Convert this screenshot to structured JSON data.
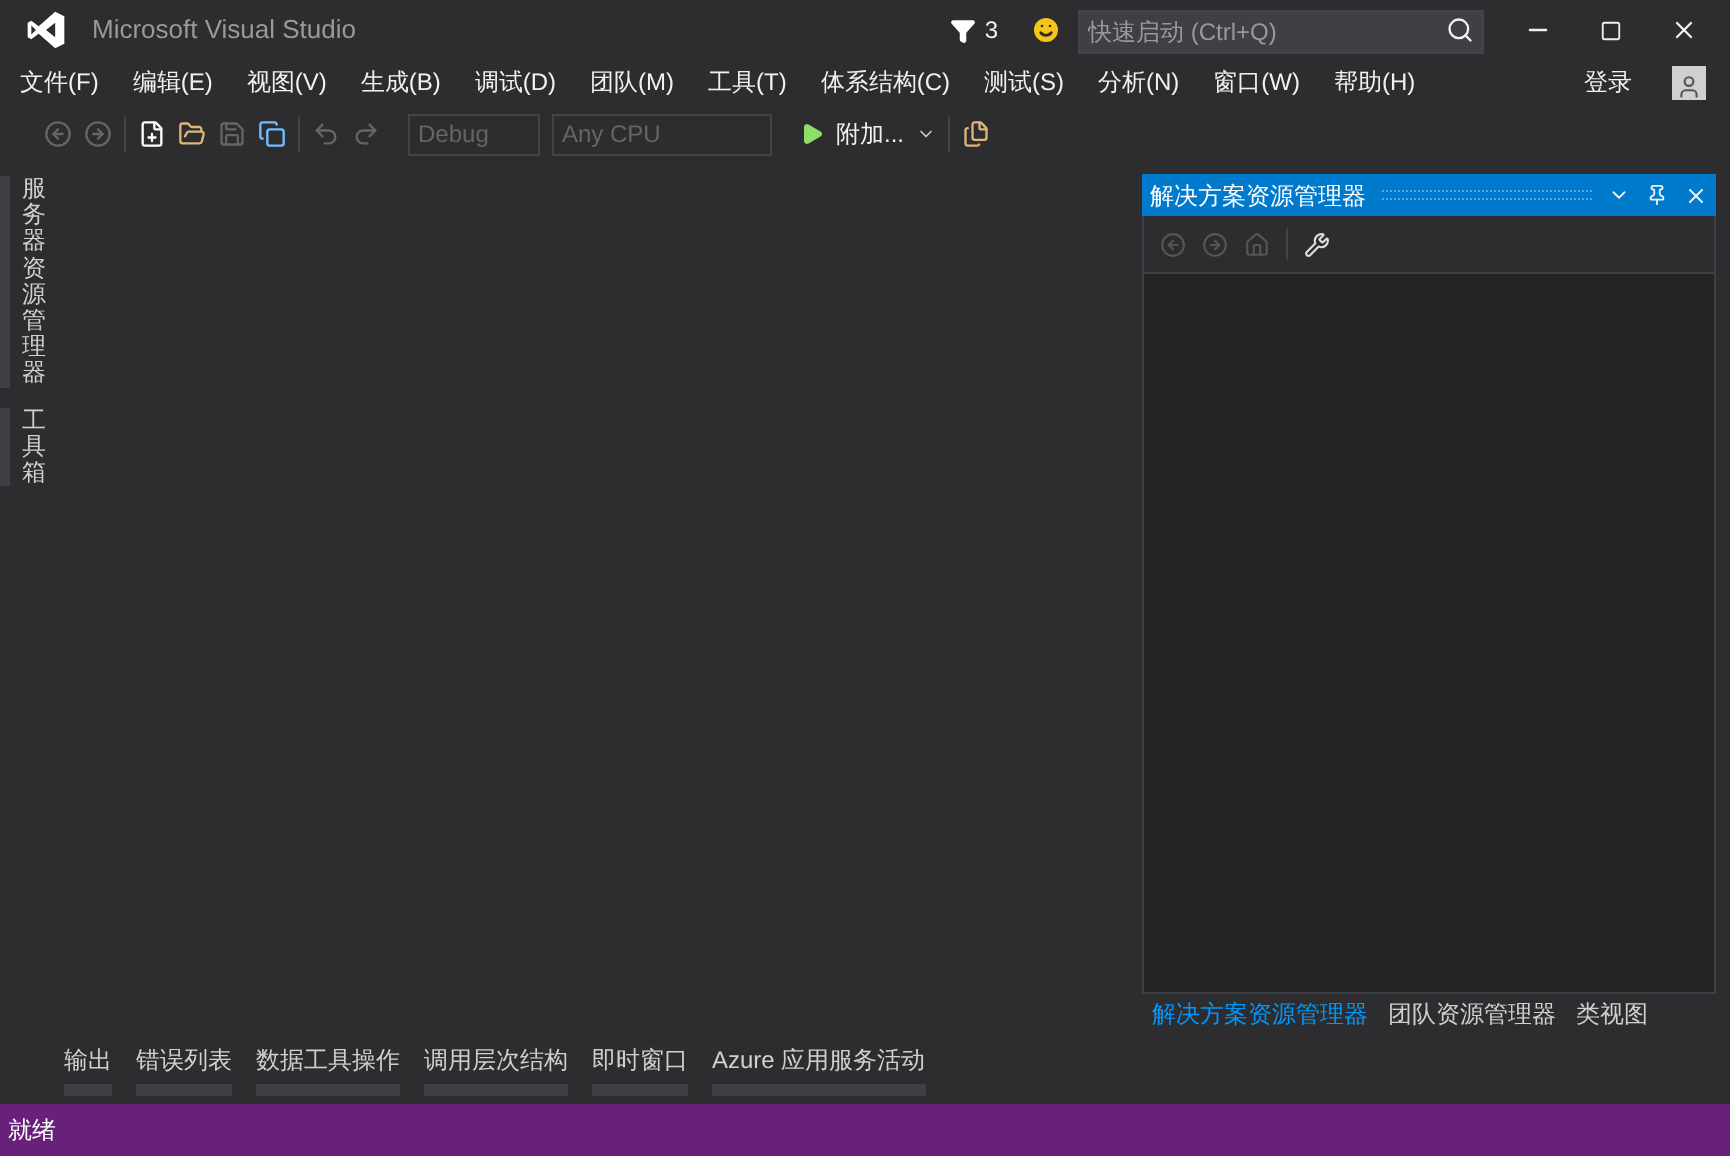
{
  "title_bar": {
    "title": "Microsoft Visual Studio",
    "notification_count": "3",
    "quick_launch": {
      "placeholder": "快速启动 (Ctrl+Q)"
    }
  },
  "menu": [
    {
      "label": "文件(F)"
    },
    {
      "label": "编辑(E)"
    },
    {
      "label": "视图(V)"
    },
    {
      "label": "生成(B)"
    },
    {
      "label": "调试(D)"
    },
    {
      "label": "团队(M)"
    },
    {
      "label": "工具(T)"
    },
    {
      "label": "体系结构(C)"
    },
    {
      "label": "测试(S)"
    },
    {
      "label": "分析(N)"
    },
    {
      "label": "窗口(W)"
    },
    {
      "label": "帮助(H)"
    }
  ],
  "sign_in": "登录",
  "toolbar": {
    "configuration": "Debug",
    "platform": "Any CPU",
    "start": "附加..."
  },
  "left_tabs": [
    {
      "label": "服务器资源管理器"
    },
    {
      "label": "工具箱"
    }
  ],
  "solution_explorer": {
    "title": "解决方案资源管理器",
    "tabs": [
      {
        "label": "解决方案资源管理器",
        "selected": true
      },
      {
        "label": "团队资源管理器",
        "selected": false
      },
      {
        "label": "类视图",
        "selected": false
      }
    ]
  },
  "bottom_tabs": [
    {
      "label": "输出"
    },
    {
      "label": "错误列表"
    },
    {
      "label": "数据工具操作"
    },
    {
      "label": "调用层次结构"
    },
    {
      "label": "即时窗口"
    },
    {
      "label": "Azure 应用服务活动"
    }
  ],
  "status_bar": {
    "text": "就绪"
  }
}
